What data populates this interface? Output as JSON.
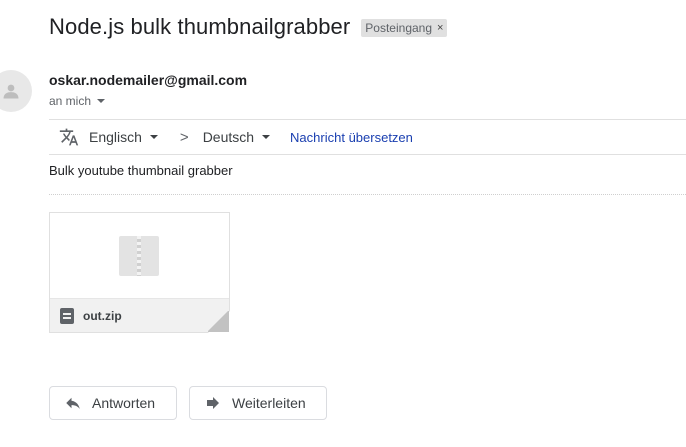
{
  "email": {
    "subject": "Node.js bulk thumbnailgrabber",
    "label": "Posteingang",
    "label_remove": "×",
    "sender": "oskar.nodemailer@gmail.com",
    "recipient": "an mich"
  },
  "translate": {
    "from_lang": "Englisch",
    "chevron": ">",
    "to_lang": "Deutsch",
    "action": "Nachricht übersetzen"
  },
  "body": {
    "text": "Bulk youtube thumbnail grabber"
  },
  "attachment": {
    "name": "out.zip",
    "type_icon": "zip-icon"
  },
  "actions": {
    "reply_label": "Antworten",
    "forward_label": "Weiterleiten"
  }
}
